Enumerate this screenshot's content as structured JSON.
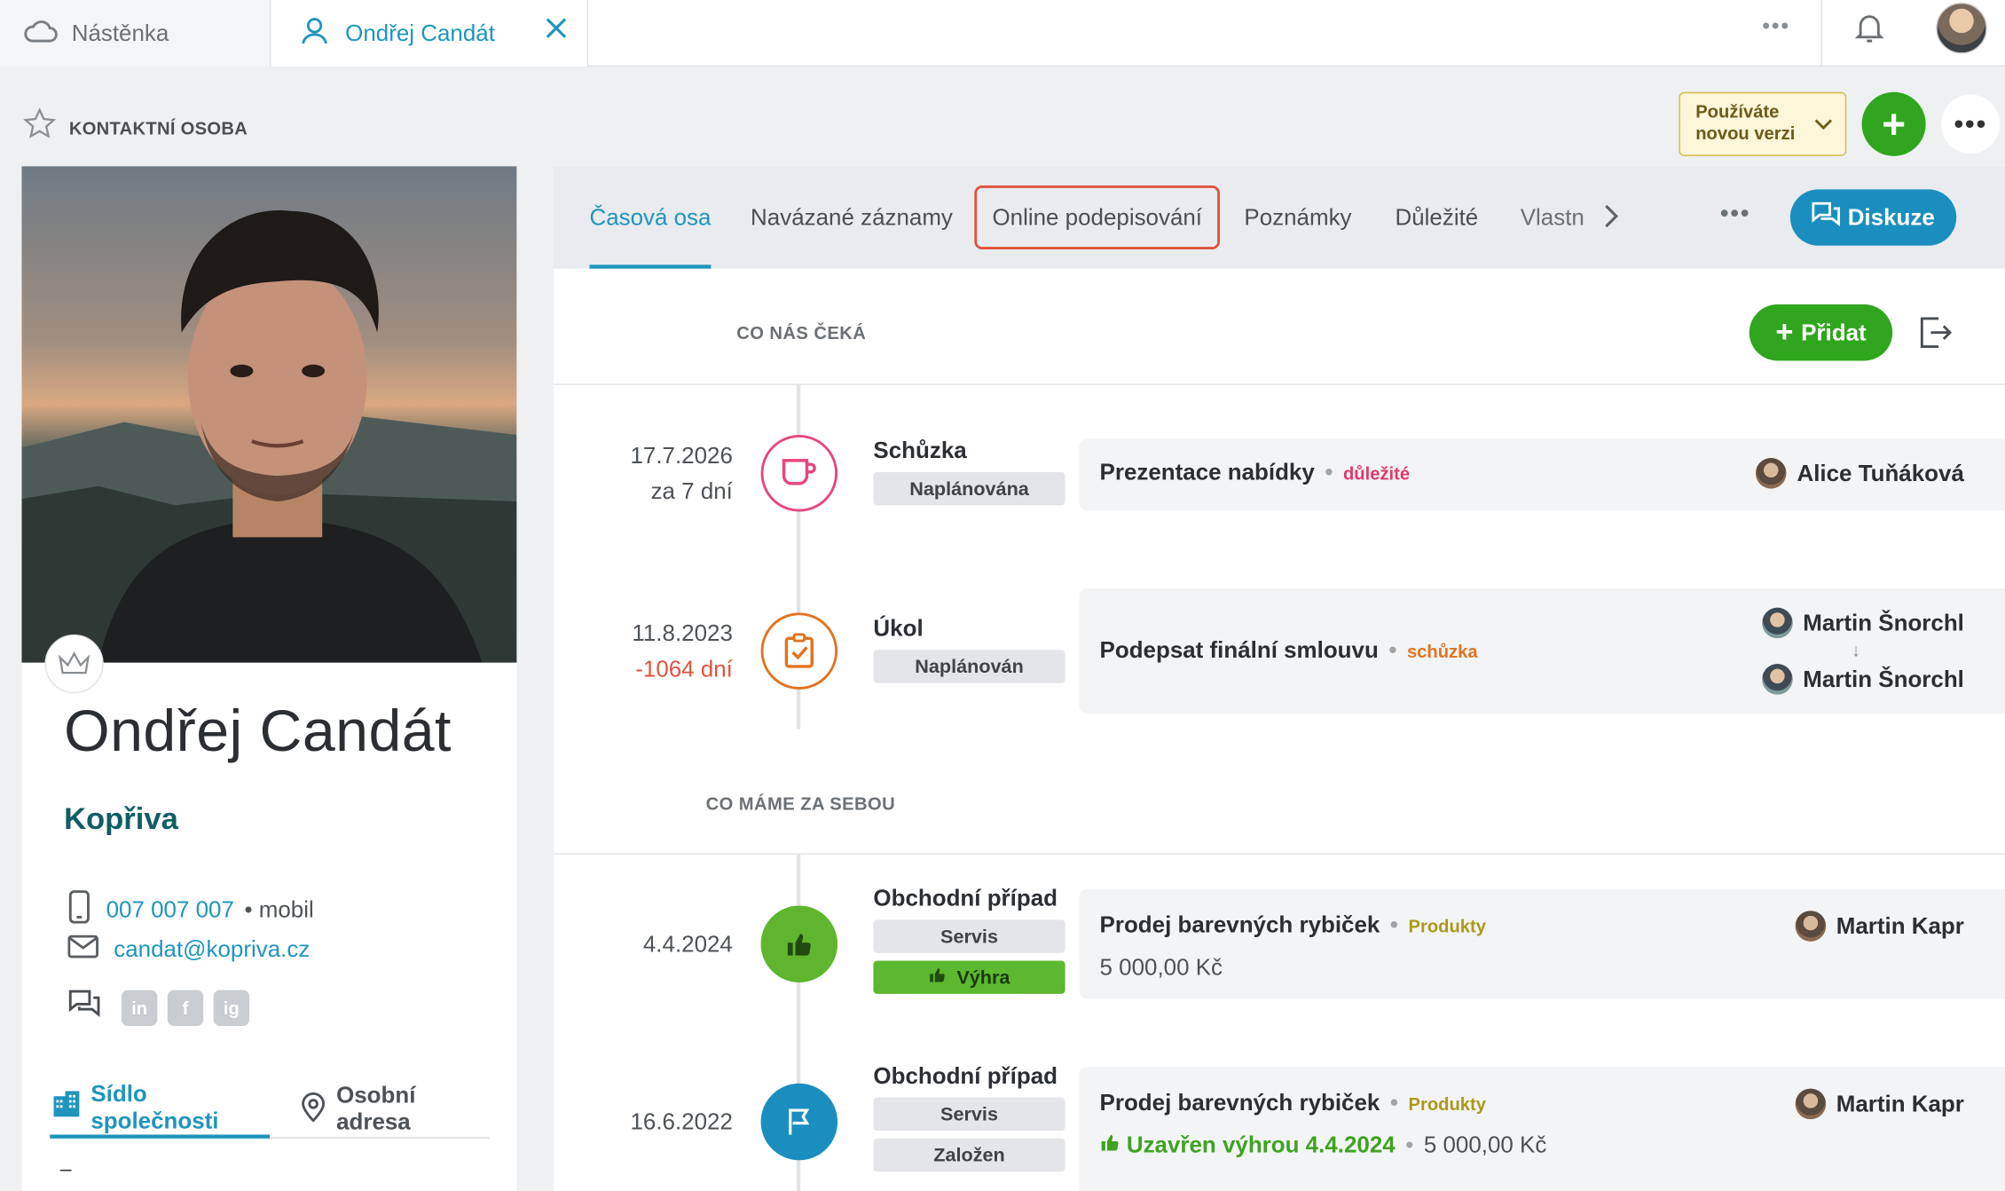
{
  "colors": {
    "accent": "#1f95bd",
    "green": "#2fa61d",
    "danger": "#e0533c",
    "important": "#e03a6a"
  },
  "topbar": {
    "tab_dashboard": "Nástěnka",
    "tab_contact": "Ondřej Candát"
  },
  "header": {
    "label": "KONTAKTNÍ OSOBA",
    "version_line1": "Používáte",
    "version_line2": "novou verzi"
  },
  "profile": {
    "name": "Ondřej Candát",
    "company": "Kopřiva",
    "phone": "007 007 007",
    "phone_type": "• mobil",
    "email": "candat@kopriva.cz",
    "social": [
      "in",
      "f",
      "ig"
    ],
    "addr_tab_active": "Sídlo společnosti",
    "addr_tab_other": "Osobní adresa",
    "addr_value": "–"
  },
  "tabs": {
    "items": [
      "Časová osa",
      "Navázané záznamy",
      "Online podepisování",
      "Poznámky",
      "Důležité",
      "Vlastn"
    ],
    "discuss": "Diskuze"
  },
  "upcoming": {
    "label": "CO NÁS ČEKÁ",
    "add": "Přidat"
  },
  "past": {
    "label": "CO MÁME ZA SEBOU"
  },
  "rows": [
    {
      "date": "17.7.2026",
      "rel": "za 7 dní",
      "type": "Schůzka",
      "status": "Naplánována",
      "title": "Prezentace nabídky",
      "tag": "důležité",
      "owner": "Alice Tuňáková"
    },
    {
      "date": "11.8.2023",
      "rel": "-1064 dní",
      "type": "Úkol",
      "status": "Naplánován",
      "title": "Podepsat finální smlouvu",
      "tag": "schůzka",
      "owner_from": "Martin Šnorchl",
      "owner_to": "Martin Šnorchl"
    },
    {
      "date": "4.4.2024",
      "type": "Obchodní případ",
      "status": "Servis",
      "status2": "Výhra",
      "title": "Prodej barevných rybiček",
      "tag": "Produkty",
      "amount": "5 000,00 Kč",
      "owner": "Martin Kapr"
    },
    {
      "date": "16.6.2022",
      "type": "Obchodní případ",
      "status": "Servis",
      "status2": "Založen",
      "title": "Prodej barevných rybiček",
      "tag": "Produkty",
      "won_text": "Uzavřen výhrou 4.4.2024",
      "amount": "5 000,00 Kč",
      "owner": "Martin Kapr"
    }
  ]
}
